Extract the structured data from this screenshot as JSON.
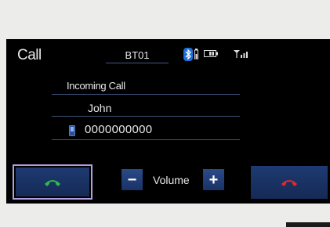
{
  "screen": {
    "title": "Call",
    "device_name": "BT01"
  },
  "status_icons": {
    "bluetooth": "bluetooth-icon",
    "phone_battery": "phone-battery-icon",
    "battery": "battery-icon",
    "signal": "signal-strength-icon"
  },
  "call": {
    "status": "Incoming Call",
    "caller_name": "John",
    "phone_number": "0000000000"
  },
  "controls": {
    "answer_icon": "answer-phone-icon",
    "volume_down": "−",
    "volume_label": "Volume",
    "volume_up": "+",
    "end_icon": "end-call-icon"
  },
  "colors": {
    "answer": "#2fb84e",
    "end": "#e8262a",
    "accent": "#2a4a88",
    "focus": "#b49ee0"
  }
}
